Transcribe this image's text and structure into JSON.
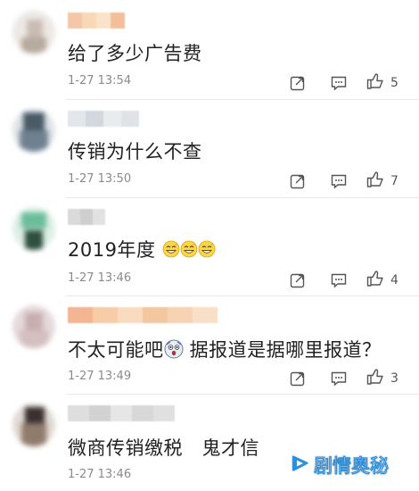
{
  "comments": [
    {
      "content": "给了多少广告费",
      "time": "1-27 13:54",
      "likes": "5",
      "name_colors": [
        "#f5c6a8",
        "#f8d9b7",
        "#f9e3c9",
        "#f4c09c"
      ],
      "avatar_colors": [
        "#e6e2de",
        "#cfc6be",
        "#b8aba0",
        "#efecea"
      ]
    },
    {
      "content": "传销为什么不查",
      "time": "1-27 13:50",
      "likes": "7",
      "name_colors": [
        "#e3e6ea",
        "#d3d8de",
        "#e9ecef",
        "#dfe3e8"
      ],
      "avatar_colors": [
        "#5a6b78",
        "#3f4e5a",
        "#7b8c99",
        "#cfd6dc"
      ]
    },
    {
      "content": "2019年度",
      "time": "1-27 13:46",
      "likes": "4",
      "name_colors": [
        "#dadada",
        "#cfcfcf",
        "#e2e2e2"
      ],
      "avatar_colors": [
        "#6bbd9a",
        "#2f4f3f",
        "#8fd3b4",
        "#e0efe6"
      ]
    },
    {
      "content_main": "不太可能吧",
      "content_tail": " 据报道是据哪里报道？",
      "time": "1-27 13:49",
      "likes": "3",
      "name_colors": [
        "#f4b592",
        "#f7cda8",
        "#f9dcc0",
        "#f3c7a0",
        "#f6d3b2",
        "#f8e0c8"
      ],
      "avatar_colors": [
        "#d9c4c6",
        "#bda3a6",
        "#e8dcdd",
        "#cdb3b6"
      ]
    },
    {
      "content": "微商传销缴税　鬼才信",
      "time": "1-27 13:46",
      "likes": "",
      "name_colors": [
        "#dedede",
        "#d2d2d2",
        "#e6e6e6",
        "#d8d8d8",
        "#e0e0e0"
      ],
      "avatar_colors": [
        "#3a3030",
        "#7a6a5e",
        "#b9a492",
        "#e4dcd6"
      ]
    }
  ],
  "watermark": {
    "text": "剧情奥秘",
    "color": "#2f8fd8"
  },
  "icons": {
    "share": "share-icon",
    "comment": "comment-icon",
    "like": "thumbs-up-icon"
  }
}
